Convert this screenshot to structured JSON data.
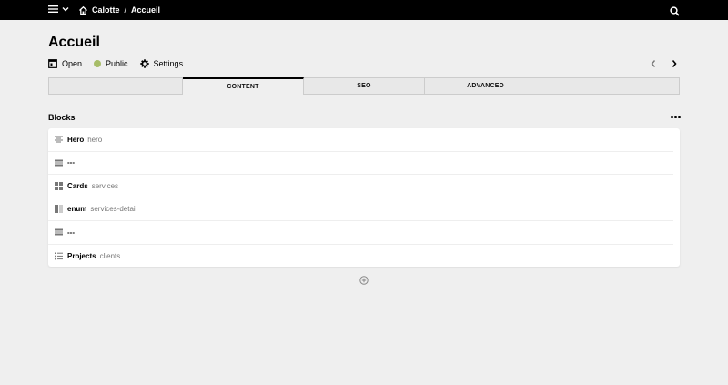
{
  "breadcrumb": {
    "site": "Calotte",
    "separator": "/",
    "page": "Accueil"
  },
  "page": {
    "title": "Accueil"
  },
  "actions": {
    "open": "Open",
    "status": "Public",
    "status_color": "#a7bd68",
    "settings": "Settings"
  },
  "tabs": [
    {
      "label": ""
    },
    {
      "label": "CONTENT"
    },
    {
      "label": "SEO"
    },
    {
      "label": "ADVANCED"
    }
  ],
  "blocks": {
    "title": "Blocks",
    "items": [
      {
        "icon": "text-center-icon",
        "name": "Hero",
        "sub": "hero"
      },
      {
        "icon": "divider-icon",
        "name": "---",
        "sub": ""
      },
      {
        "icon": "grid-icon",
        "name": "Cards",
        "sub": "services"
      },
      {
        "icon": "columns-icon",
        "name": "enum",
        "sub": "services-detail"
      },
      {
        "icon": "divider-icon",
        "name": "---",
        "sub": ""
      },
      {
        "icon": "list-icon",
        "name": "Projects",
        "sub": "clients"
      }
    ]
  }
}
